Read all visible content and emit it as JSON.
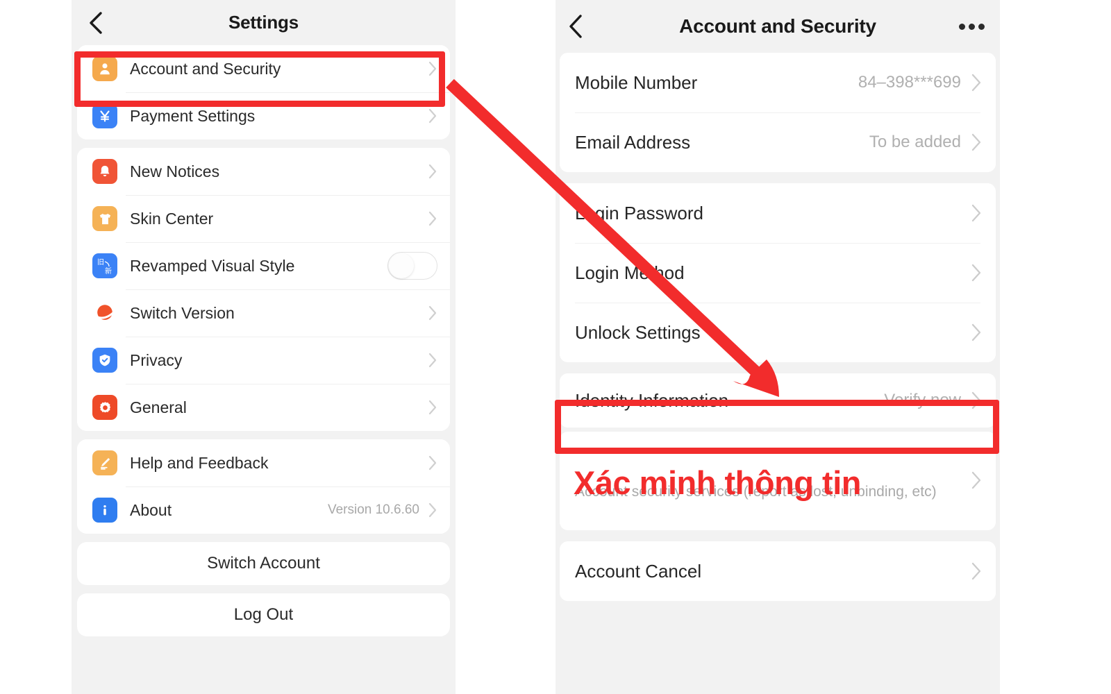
{
  "left_panel": {
    "nav": {
      "back_icon": "chevron-left-icon",
      "title": "Settings"
    },
    "groups": [
      {
        "rows": [
          {
            "label": "Account and Security",
            "icon": "person-icon",
            "icon_color": "#f5a94d",
            "aux": "",
            "control": "chevron"
          },
          {
            "label": "Payment Settings",
            "icon": "yuan-icon",
            "icon_color": "#3b82f6",
            "aux": "",
            "control": "chevron"
          }
        ]
      },
      {
        "rows": [
          {
            "label": "New Notices",
            "icon": "bell-icon",
            "icon_color": "#f05436",
            "aux": "",
            "control": "chevron"
          },
          {
            "label": "Skin Center",
            "icon": "tshirt-icon",
            "icon_color": "#f5b256",
            "aux": "",
            "control": "chevron"
          },
          {
            "label": "Revamped Visual Style",
            "icon": "old-new-switch-icon",
            "icon_color": "#3b82f6",
            "aux": "",
            "control": "toggle",
            "toggle_on": false
          },
          {
            "label": "Switch Version",
            "icon": "saturn-planet-icon",
            "icon_color": "#f0522a",
            "aux": "",
            "control": "chevron"
          },
          {
            "label": "Privacy",
            "icon": "shield-check-icon",
            "icon_color": "#3b82f6",
            "aux": "",
            "control": "chevron"
          },
          {
            "label": "General",
            "icon": "gear-icon",
            "icon_color": "#ee4a28",
            "aux": "",
            "control": "chevron"
          }
        ]
      },
      {
        "rows": [
          {
            "label": "Help and Feedback",
            "icon": "pencil-note-icon",
            "icon_color": "#f5b256",
            "aux": "",
            "control": "chevron"
          },
          {
            "label": "About",
            "icon": "info-icon",
            "icon_color": "#2f7df0",
            "aux": "Version 10.6.60",
            "control": "chevron"
          }
        ]
      }
    ],
    "buttons": [
      {
        "label": "Switch Account"
      },
      {
        "label": "Log Out"
      }
    ]
  },
  "right_panel": {
    "nav": {
      "back_icon": "chevron-left-icon",
      "title": "Account and Security",
      "more_icon": "more-horizontal-icon"
    },
    "groups": [
      {
        "rows": [
          {
            "label": "Mobile Number",
            "value": "84–398***699"
          },
          {
            "label": "Email Address",
            "value": "To be added"
          }
        ]
      },
      {
        "rows": [
          {
            "label": "Login Password",
            "value": ""
          },
          {
            "label": "Login Method",
            "value": ""
          },
          {
            "label": "Unlock Settings",
            "value": ""
          }
        ]
      },
      {
        "rows": [
          {
            "label": "Identity Information",
            "value": "Verify now"
          }
        ]
      },
      {
        "rows": [
          {
            "label": "",
            "desc": "Account security services (report as lost, unbinding, etc)",
            "value": ""
          }
        ]
      },
      {
        "rows": [
          {
            "label": "Account Cancel",
            "value": ""
          }
        ]
      }
    ]
  },
  "annotations": {
    "color": "#f22c2c",
    "vietnamese_caption": "Xác minh thông tin",
    "highlight_left_target": "Account and Security",
    "highlight_right_target": "Identity Information",
    "arrow": "curved-arrow-pointing-from-account-and-security-to-identity-information"
  }
}
